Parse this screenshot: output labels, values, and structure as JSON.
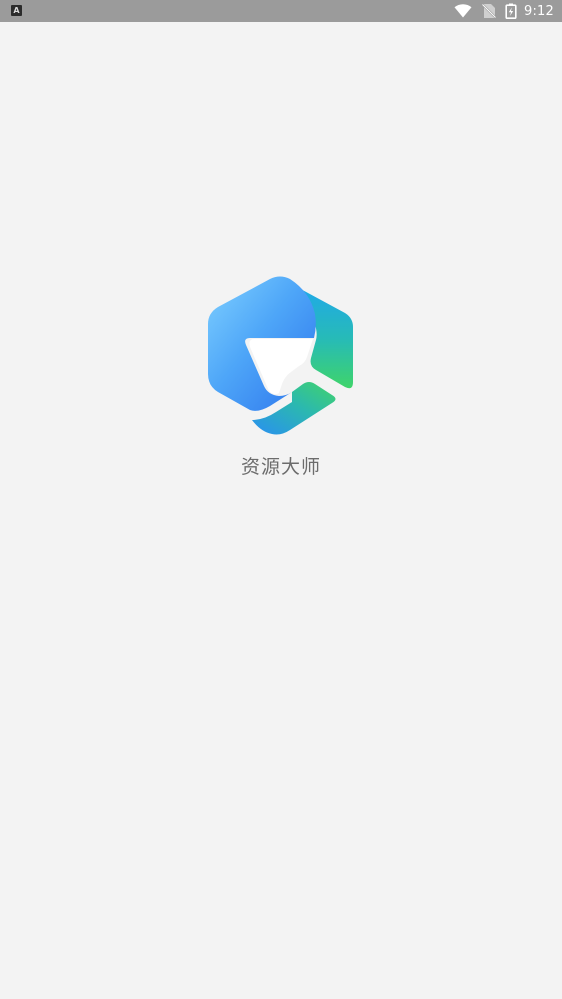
{
  "status_bar": {
    "notification_icon": "A",
    "time": "9:12",
    "icons": [
      "notification-icon",
      "wifi-icon",
      "no-sim-icon",
      "battery-icon"
    ]
  },
  "splash": {
    "app_name": "资源大师",
    "logo_icon": "hexagon-arrow-logo-icon"
  },
  "colors": {
    "background": "#f3f3f3",
    "status_bar": "#9b9b9b",
    "logo_blue_light": "#6cc4ff",
    "logo_blue": "#2f7dee",
    "logo_green": "#3ed26b",
    "app_name_text": "#6c6c6c"
  }
}
